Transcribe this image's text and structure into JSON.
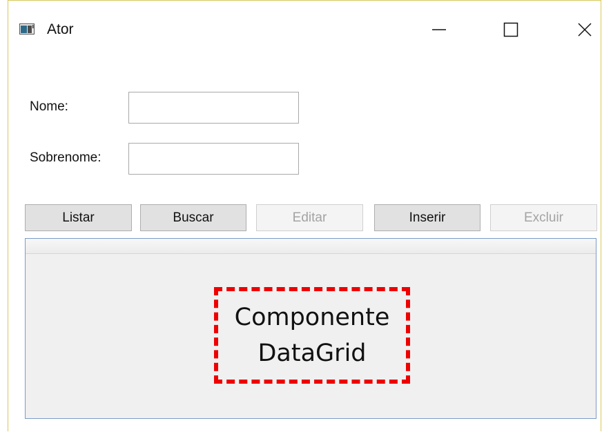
{
  "window": {
    "title": "Ator",
    "controls": {
      "minimize": "minimize",
      "maximize": "maximize",
      "close": "close"
    }
  },
  "form": {
    "nome_label": "Nome:",
    "nome_value": "",
    "sobrenome_label": "Sobrenome:",
    "sobrenome_value": ""
  },
  "buttons": {
    "listar": "Listar",
    "buscar": "Buscar",
    "editar": "Editar",
    "inserir": "Inserir",
    "excluir": "Excluir"
  },
  "buttons_state": {
    "editar_enabled": false,
    "excluir_enabled": false
  },
  "datagrid": {
    "annotation_line1": "Componente",
    "annotation_line2": "DataGrid"
  },
  "colors": {
    "annotation_border": "#ee0000",
    "grid_border": "#7a9cc7",
    "window_border": "#d8c95a"
  }
}
